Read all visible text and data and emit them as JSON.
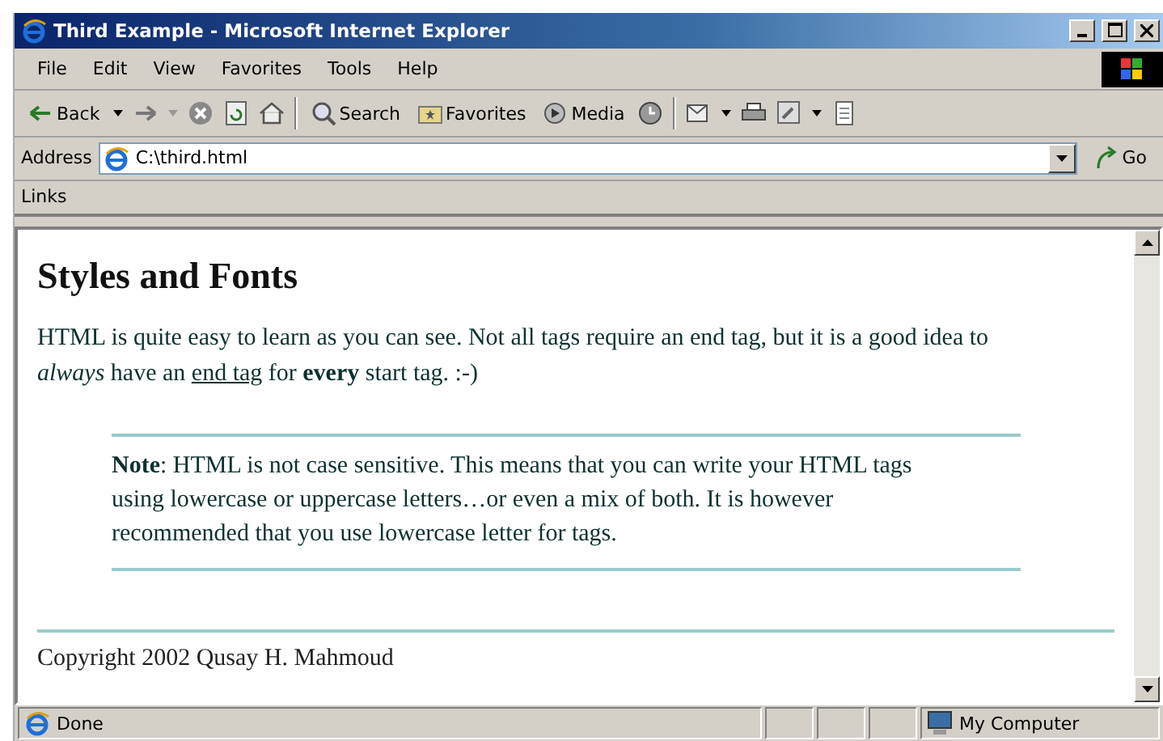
{
  "window": {
    "title": "Third Example - Microsoft Internet Explorer"
  },
  "menu": [
    "File",
    "Edit",
    "View",
    "Favorites",
    "Tools",
    "Help"
  ],
  "toolbar": {
    "back": "Back",
    "search": "Search",
    "favorites": "Favorites",
    "media": "Media"
  },
  "address_bar": {
    "label": "Address",
    "value": "C:\\third.html",
    "go": "Go"
  },
  "links_bar": {
    "label": "Links"
  },
  "page": {
    "heading": "Styles and Fonts",
    "paragraph": [
      {
        "kind": "text",
        "text": "HTML is quite easy to learn as you can see. Not all tags require an end tag, but it is a good idea to *always* have an "
      },
      {
        "kind": "link",
        "text": "end tag"
      },
      {
        "kind": "text",
        "text": " for **every** start tag. :-)"
      }
    ],
    "note": "**Note**: HTML is not case sensitive. This means that you can write your HTML tags using lowercase or uppercase letters…or even a mix of both. It is however recommended that you use lowercase letter for tags.",
    "footer": "Copyright 2002 Qusay H. Mahmoud"
  },
  "status_bar": {
    "status": "Done",
    "zone": "My Computer"
  }
}
